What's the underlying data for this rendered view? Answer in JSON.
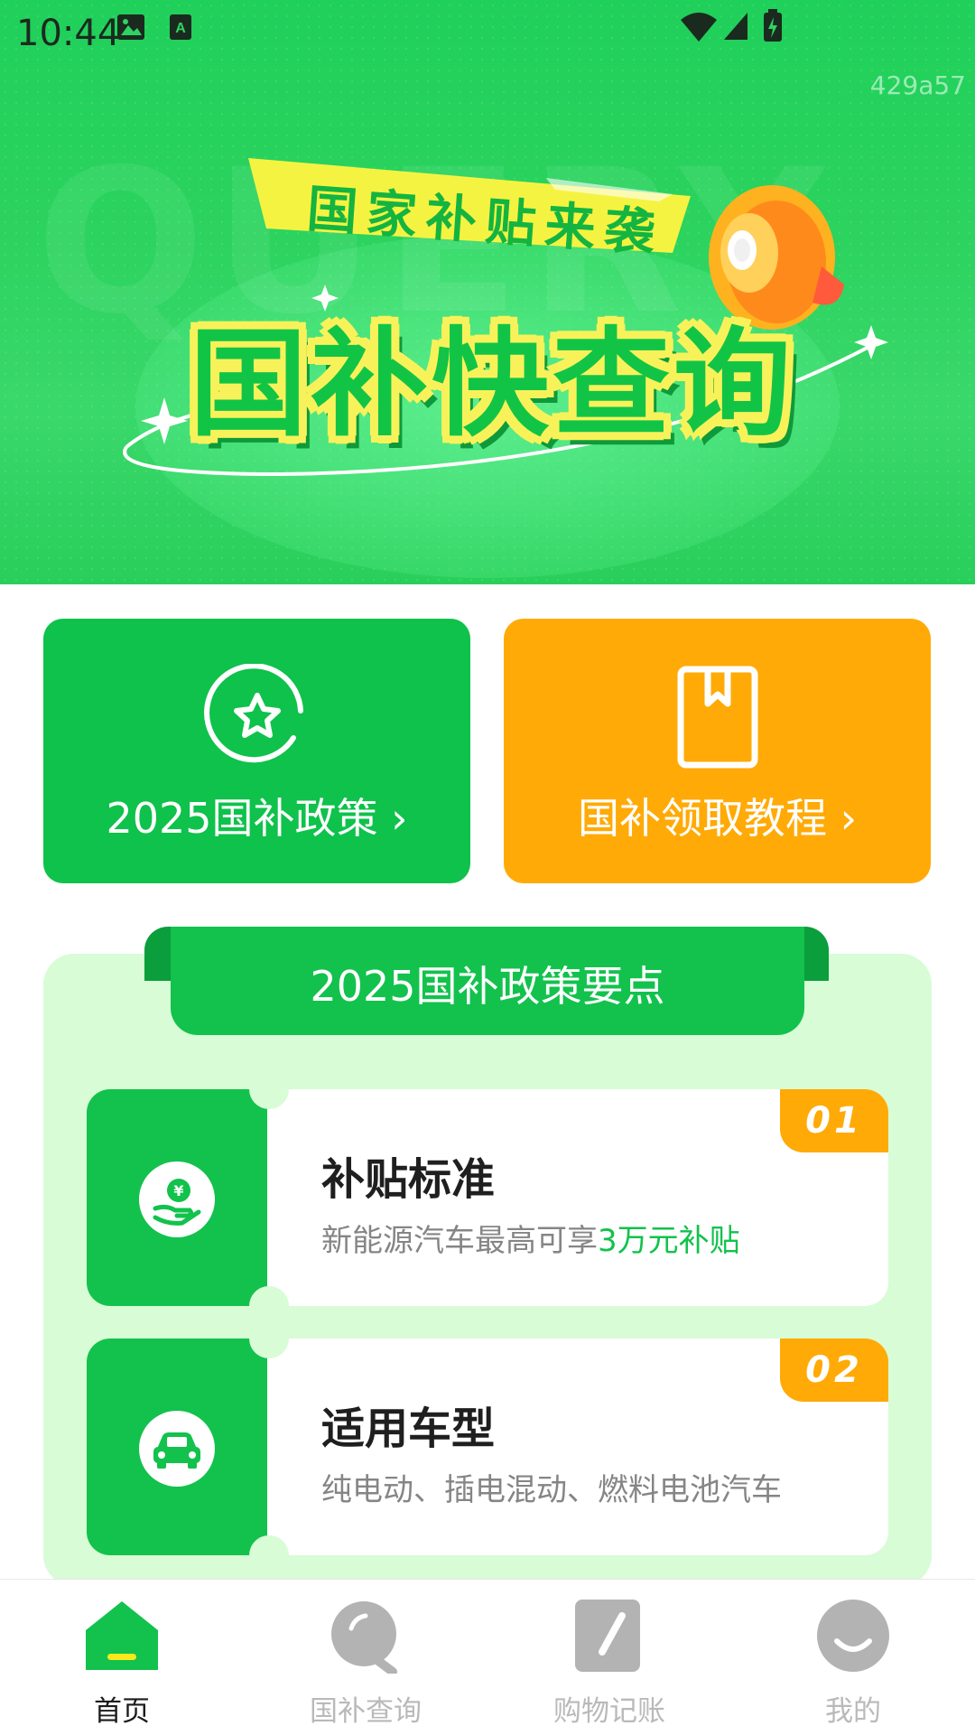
{
  "status_bar": {
    "time": "10:44",
    "icons": [
      "image-icon",
      "keyboard-icon",
      "wifi-icon",
      "signal-icon",
      "battery-icon"
    ],
    "debug_code": "429a57"
  },
  "hero": {
    "ribbon_text": "国家补贴来袭",
    "title": "国补快查询"
  },
  "quick_cards": [
    {
      "label": "2025国补政策",
      "color": "#0ec24b",
      "icon": "star-badge-icon"
    },
    {
      "label": "国补领取教程",
      "color": "#ffaa06",
      "icon": "book-bookmark-icon"
    }
  ],
  "policy": {
    "title": "2025国补政策要点",
    "items": [
      {
        "number": "01",
        "title": "补贴标准",
        "desc_prefix": "新能源汽车最高可享",
        "desc_highlight": "3万元补贴",
        "icon": "money-hand-icon"
      },
      {
        "number": "02",
        "title": "适用车型",
        "desc_prefix": "纯电动、插电混动、燃料电池汽车",
        "desc_highlight": "",
        "icon": "car-icon"
      }
    ]
  },
  "nav": {
    "items": [
      {
        "label": "首页",
        "icon": "home-icon",
        "active": true
      },
      {
        "label": "国补查询",
        "icon": "search-icon",
        "active": false
      },
      {
        "label": "购物记账",
        "icon": "ledger-icon",
        "active": false
      },
      {
        "label": "我的",
        "icon": "profile-icon",
        "active": false
      }
    ]
  },
  "colors": {
    "primary_green": "#12c24c",
    "accent_orange": "#ffaa06",
    "highlight_yellow": "#f8f25a",
    "section_bg": "#d8fcd6"
  }
}
